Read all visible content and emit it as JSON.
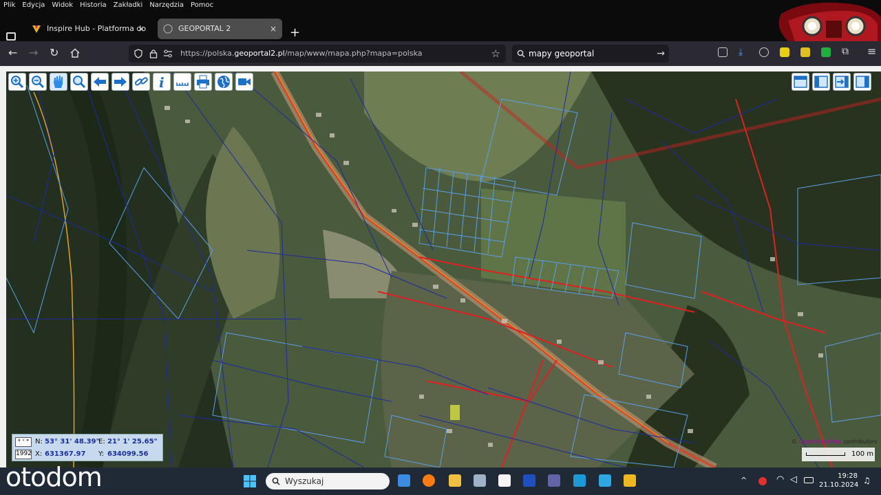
{
  "browser": {
    "menu": [
      "Plik",
      "Edycja",
      "Widok",
      "Historia",
      "Zakładki",
      "Narzędzia",
      "Pomoc"
    ],
    "tabs": [
      {
        "title": "Inspire Hub - Platforma do pub",
        "close": "×"
      },
      {
        "title": "GEOPORTAL 2",
        "close": "×"
      }
    ],
    "new_tab": "+",
    "url_prefix": "https://polska.",
    "url_domain": "geoportal2.pl",
    "url_path": "/map/www/mapa.php?mapa=polska",
    "search_value": "mapy geoportal",
    "colors": {
      "chrome": "#2b2a33",
      "tab_active": "#4d4d4d"
    }
  },
  "toolbar": {
    "tools": [
      "zoom-in-icon",
      "zoom-out-icon",
      "pan-hand-icon",
      "zoom-extent-icon",
      "back-arrow-icon",
      "forward-arrow-icon",
      "link-icon",
      "info-icon",
      "measure-icon",
      "print-icon",
      "globe-icon",
      "video-icon"
    ],
    "right_tools": [
      "layout-top-icon",
      "layout-left-icon",
      "layout-export-icon",
      "layout-right-icon"
    ]
  },
  "coords": {
    "deg_label": "° ' \"",
    "system": "1992",
    "n_label": "N:",
    "n_value": "53° 31' 48.39\"",
    "e_label": "E:",
    "e_value": "21° 1' 25.65\"",
    "x_label": "X:",
    "x_value": "631367.97",
    "y_label": "Y:",
    "y_value": "634099.56"
  },
  "map": {
    "attribution_a": "© ",
    "attribution_b": "OpenStreetMap",
    "attribution_c": " contributors",
    "scale_label": "100 m",
    "colors": {
      "parcel": "#5aa0e8",
      "parcel_dark": "#1c2aa0",
      "road": "#e02020",
      "road_line": "#f0a020"
    }
  },
  "taskbar": {
    "search_placeholder": "Wyszukaj",
    "time": "19:28",
    "date": "21.10.2024"
  },
  "watermark": "otodom"
}
